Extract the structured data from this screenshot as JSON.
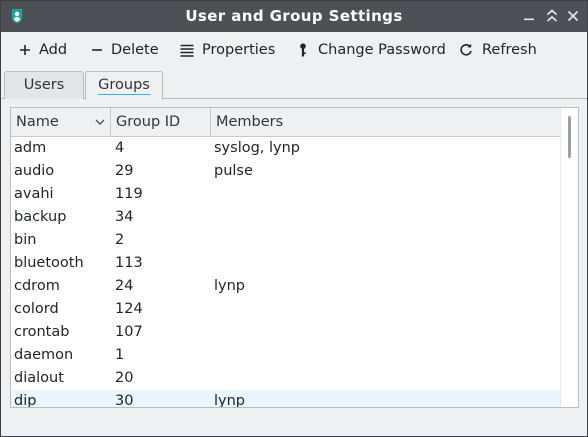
{
  "window": {
    "title": "User and Group Settings"
  },
  "toolbar": {
    "add_label": "Add",
    "delete_label": "Delete",
    "properties_label": "Properties",
    "change_password_label": "Change Password",
    "refresh_label": "Refresh"
  },
  "tabs": [
    {
      "label": "Users"
    },
    {
      "label": "Groups"
    }
  ],
  "active_tab": "Groups",
  "table": {
    "columns": [
      "Name",
      "Group ID",
      "Members"
    ],
    "rows": [
      {
        "name": "adm",
        "gid": "4",
        "members": "syslog, lynp"
      },
      {
        "name": "audio",
        "gid": "29",
        "members": "pulse"
      },
      {
        "name": "avahi",
        "gid": "119",
        "members": ""
      },
      {
        "name": "backup",
        "gid": "34",
        "members": ""
      },
      {
        "name": "bin",
        "gid": "2",
        "members": ""
      },
      {
        "name": "bluetooth",
        "gid": "113",
        "members": ""
      },
      {
        "name": "cdrom",
        "gid": "24",
        "members": "lynp"
      },
      {
        "name": "colord",
        "gid": "124",
        "members": ""
      },
      {
        "name": "crontab",
        "gid": "107",
        "members": ""
      },
      {
        "name": "daemon",
        "gid": "1",
        "members": ""
      },
      {
        "name": "dialout",
        "gid": "20",
        "members": ""
      },
      {
        "name": "dip",
        "gid": "30",
        "members": "lynp"
      }
    ]
  },
  "colors": {
    "titlebar": "#4d5156",
    "accent": "#3daee9",
    "app_icon": "#1fa59a",
    "row_hover": "#eaf5fd"
  }
}
